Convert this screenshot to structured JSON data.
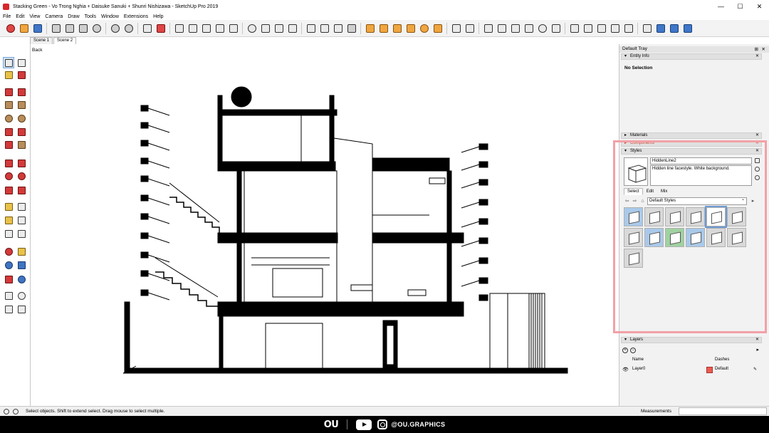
{
  "window": {
    "title": "Stacking Green - Vo Trong Nghia + Daisuke Sanuki + Shunri Nishizawa - SketchUp Pro 2019",
    "minimize": "—",
    "maximize": "☐",
    "close": "✕"
  },
  "menu": [
    "File",
    "Edit",
    "View",
    "Camera",
    "Draw",
    "Tools",
    "Window",
    "Extensions",
    "Help"
  ],
  "scene_tabs": [
    "Scene 1",
    "Scene 2"
  ],
  "viewport": {
    "back_label": "Back"
  },
  "tray": {
    "title": "Default Tray",
    "pin": "⊞",
    "close": "✕",
    "entity_info": {
      "label": "Entity Info",
      "body": "No Selection"
    },
    "materials": {
      "label": "Materials"
    },
    "components": {
      "label": "Components"
    },
    "styles": {
      "label": "Styles",
      "name": "HiddenLine2",
      "description": "Hidden line facestyle. White background.",
      "tabs": [
        "Select",
        "Edit",
        "Mix"
      ],
      "library": "Default Styles"
    },
    "layers": {
      "label": "Layers",
      "add": "+",
      "remove": "−",
      "col_name": "Name",
      "col_dashes": "Dashes",
      "rows": [
        {
          "name": "Layer0",
          "dashes": "Default",
          "color": "#ec5a4f"
        }
      ]
    }
  },
  "status": {
    "text": "Select objects. Shift to extend select. Drag mouse to select multiple.",
    "measurements_label": "Measurements"
  },
  "footer": {
    "brand": "OU",
    "handle": "@OU.GRAPHICS"
  }
}
